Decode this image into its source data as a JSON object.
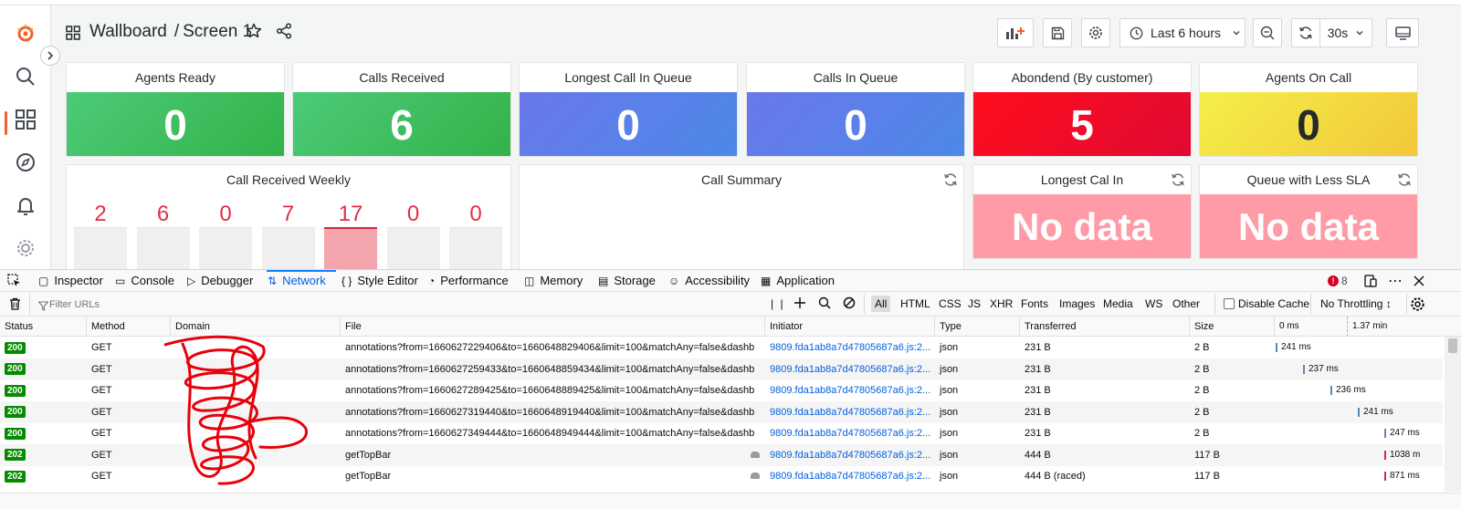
{
  "dashboard": {
    "title": "Wallboard",
    "separator": "/",
    "screen": "Screen 1",
    "time_range": "Last 6 hours",
    "refresh_interval": "30s"
  },
  "stats": [
    {
      "title": "Agents Ready",
      "value": "0",
      "color": "#3bbd68"
    },
    {
      "title": "Calls Received",
      "value": "6",
      "color": "#3bbd68"
    },
    {
      "title": "Longest Call In Queue",
      "value": "0",
      "color": "#5b7fe6"
    },
    {
      "title": "Calls In Queue",
      "value": "0",
      "color": "#5b7fe6"
    },
    {
      "title": "Abondend (By customer)",
      "value": "5",
      "color": "#ee0a26"
    },
    {
      "title": "Agents On Call",
      "value": "0",
      "color": "#f1e63e"
    }
  ],
  "weekly": {
    "title": "Call Received Weekly",
    "values": [
      "2",
      "6",
      "0",
      "7",
      "17",
      "0",
      "0"
    ],
    "highlight_index": 4
  },
  "call_summary": {
    "title": "Call Summary"
  },
  "no_data_panels": [
    {
      "title": "Longest Cal In",
      "value": "No data"
    },
    {
      "title": "Queue with Less SLA",
      "value": "No data"
    }
  ],
  "devtools": {
    "tabs": [
      "Inspector",
      "Console",
      "Debugger",
      "Network",
      "Style Editor",
      "Performance",
      "Memory",
      "Storage",
      "Accessibility",
      "Application"
    ],
    "active_tab": "Network",
    "error_count": "8",
    "filter_placeholder": "Filter URLs",
    "filters": [
      "All",
      "HTML",
      "CSS",
      "JS",
      "XHR",
      "Fonts",
      "Images",
      "Media",
      "WS",
      "Other"
    ],
    "disable_cache": "Disable Cache",
    "throttling": "No Throttling ↕",
    "columns": [
      "Status",
      "Method",
      "Domain",
      "File",
      "Initiator",
      "Type",
      "Transferred",
      "Size",
      "0 ms",
      "1.37 min"
    ],
    "rows": [
      {
        "status": "200",
        "method": "GET",
        "file": "annotations?from=1660627229406&to=1660648829406&limit=100&matchAny=false&dashb",
        "initiator": "9809.fda1ab8a7d47805687a6.js:2...",
        "type": "json",
        "transferred": "231 B",
        "size": "2 B",
        "timing": "241 ms"
      },
      {
        "status": "200",
        "method": "GET",
        "file": "annotations?from=1660627259433&to=1660648859434&limit=100&matchAny=false&dashb",
        "initiator": "9809.fda1ab8a7d47805687a6.js:2...",
        "type": "json",
        "transferred": "231 B",
        "size": "2 B",
        "timing": "237 ms"
      },
      {
        "status": "200",
        "method": "GET",
        "file": "annotations?from=1660627289425&to=1660648889425&limit=100&matchAny=false&dashb",
        "initiator": "9809.fda1ab8a7d47805687a6.js:2...",
        "type": "json",
        "transferred": "231 B",
        "size": "2 B",
        "timing": "236 ms"
      },
      {
        "status": "200",
        "method": "GET",
        "file": "annotations?from=1660627319440&to=1660648919440&limit=100&matchAny=false&dashb",
        "initiator": "9809.fda1ab8a7d47805687a6.js:2...",
        "type": "json",
        "transferred": "231 B",
        "size": "2 B",
        "timing": "241 ms"
      },
      {
        "status": "200",
        "method": "GET",
        "file": "annotations?from=1660627349444&to=1660648949444&limit=100&matchAny=false&dashb",
        "initiator": "9809.fda1ab8a7d47805687a6.js:2...",
        "type": "json",
        "transferred": "231 B",
        "size": "2 B",
        "timing": "247 ms"
      },
      {
        "status": "202",
        "method": "GET",
        "file": "getTopBar",
        "initiator": "9809.fda1ab8a7d47805687a6.js:2...",
        "type": "json",
        "transferred": "444 B",
        "size": "117 B",
        "timing": "1038 m"
      },
      {
        "status": "202",
        "method": "GET",
        "file": "getTopBar",
        "initiator": "9809.fda1ab8a7d47805687a6.js:2...",
        "type": "json",
        "transferred": "444 B (raced)",
        "size": "117 B",
        "timing": "871 ms"
      }
    ]
  },
  "colors": {
    "grafana_orange": "#f0602a",
    "no_data_pink": "#ff9aa7",
    "status_ok_green": "#058b00",
    "devtools_blue": "#0060df"
  }
}
